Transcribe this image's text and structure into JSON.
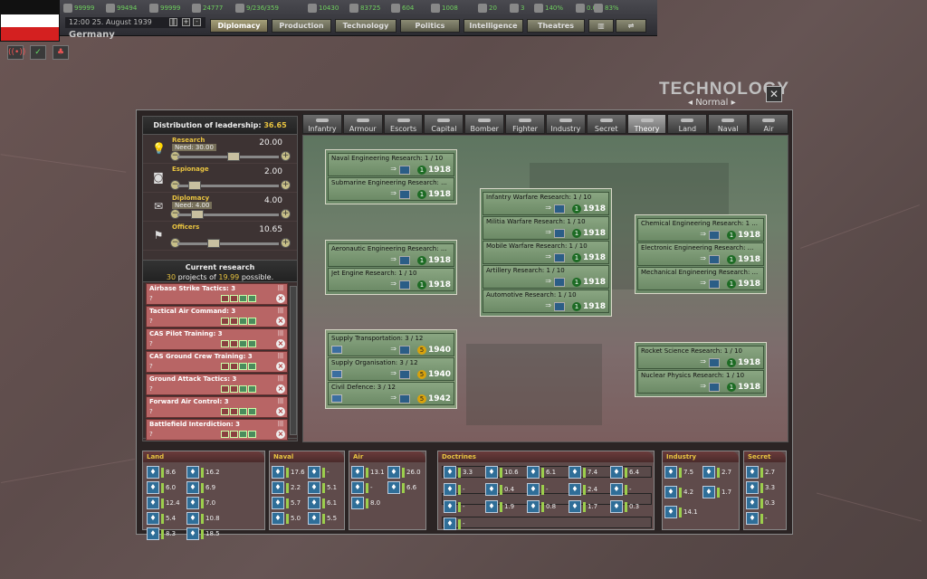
{
  "topbar": {
    "resources": [
      {
        "icon": "energy-icon",
        "value": "99999"
      },
      {
        "icon": "metal-icon",
        "value": "99494"
      },
      {
        "icon": "rare-materials-icon",
        "value": "99999"
      },
      {
        "icon": "oil-icon",
        "value": "24777"
      },
      {
        "icon": "supplies-icon",
        "value": "9/236/359"
      },
      {
        "icon": "money-icon",
        "value": "10430"
      },
      {
        "icon": "fuel-icon",
        "value": "83725"
      },
      {
        "icon": "transport-icon",
        "value": "604"
      },
      {
        "icon": "manpower-icon",
        "value": "1008"
      },
      {
        "icon": "diplomats-icon",
        "value": "20"
      },
      {
        "icon": "spies-icon",
        "value": "3"
      },
      {
        "icon": "dissent-icon",
        "value": "140%"
      },
      {
        "icon": "unity-icon",
        "value": "0.00"
      },
      {
        "icon": "neutrality-icon",
        "value": "83%"
      }
    ],
    "date": "12:00 25. August 1939",
    "country": "Germany",
    "flag_colors": [
      "#111111",
      "#ffffff",
      "#d42020"
    ],
    "tabs": [
      {
        "label": "Diplomacy",
        "active": true
      },
      {
        "label": "Production",
        "active": false
      },
      {
        "label": "Technology",
        "active": false
      },
      {
        "label": "Politics",
        "active": false
      },
      {
        "label": "Intelligence",
        "active": false
      },
      {
        "label": "Theatres",
        "active": false
      }
    ]
  },
  "window": {
    "title": "TECHNOLOGY",
    "subtitle": "Normal",
    "close": "✕"
  },
  "leadership": {
    "title": "Distribution of leadership:",
    "total": "36.65",
    "slots": [
      {
        "name": "Research",
        "need": "Need: 30.00",
        "value": "20.00",
        "icon": "lightbulb-icon",
        "pos": 0.55
      },
      {
        "name": "Espionage",
        "need": "",
        "value": "2.00",
        "icon": "camera-icon",
        "pos": 0.12
      },
      {
        "name": "Diplomacy",
        "need": "Need: 4.00",
        "value": "4.00",
        "icon": "envelope-icon",
        "pos": 0.15
      },
      {
        "name": "Officers",
        "need": "",
        "value": "10.65",
        "icon": "checkered-flag-icon",
        "pos": 0.33
      }
    ]
  },
  "current_research": {
    "title": "Current research",
    "projects": "30",
    "projects_text": "projects of",
    "possible": "19.99",
    "possible_text": "possible.",
    "items": [
      "Airbase Strike Tactics: 3",
      "Tactical Air Command: 3",
      "CAS Pilot Training: 3",
      "CAS Ground Crew Training: 3",
      "Ground Attack Tactics: 3",
      "Forward Air Control: 3",
      "Battlefield Interdiction: 3"
    ],
    "placeholder": "?"
  },
  "tech_tabs": [
    "Infantry",
    "Armour",
    "Escorts",
    "Capital",
    "Bomber",
    "Fighter",
    "Industry",
    "Secret",
    "Theory",
    "Land",
    "Naval",
    "Air"
  ],
  "active_tab": "Theory",
  "tech_groups": [
    {
      "id": "naval-eng",
      "items": [
        {
          "name": "Naval Engineering Research: 1 / 10",
          "level": "1",
          "year": "1918"
        },
        {
          "name": "Submarine Engineering Research: ...",
          "level": "1",
          "year": "1918"
        }
      ]
    },
    {
      "id": "aero",
      "items": [
        {
          "name": "Aeronautic Engineering Research: ...",
          "level": "1",
          "year": "1918"
        },
        {
          "name": "Jet Engine Research: 1 / 10",
          "level": "1",
          "year": "1918"
        }
      ]
    },
    {
      "id": "supply",
      "items": [
        {
          "name": "Supply Transportation: 3 / 12",
          "level": "5",
          "year": "1940"
        },
        {
          "name": "Supply Organisation: 3 / 12",
          "level": "5",
          "year": "1940"
        },
        {
          "name": "Civil Defence: 3 / 12",
          "level": "5",
          "year": "1942"
        }
      ]
    },
    {
      "id": "warfare",
      "items": [
        {
          "name": "Infantry Warfare Research: 1 / 10",
          "level": "1",
          "year": "1918"
        },
        {
          "name": "Militia Warfare Research: 1 / 10",
          "level": "1",
          "year": "1918"
        },
        {
          "name": "Mobile Warfare Research: 1 / 10",
          "level": "1",
          "year": "1918"
        },
        {
          "name": "Artillery Research: 1 / 10",
          "level": "1",
          "year": "1918"
        },
        {
          "name": "Automotive Research: 1 / 10",
          "level": "1",
          "year": "1918"
        }
      ]
    },
    {
      "id": "engineering",
      "items": [
        {
          "name": "Chemical Engineering Research: 1 ...",
          "level": "1",
          "year": "1918"
        },
        {
          "name": "Electronic Engineering Research: ...",
          "level": "1",
          "year": "1918"
        },
        {
          "name": "Mechanical Engineering Research: ...",
          "level": "1",
          "year": "1918"
        }
      ]
    },
    {
      "id": "rocket",
      "items": [
        {
          "name": "Rocket Science Research: 1 / 10",
          "level": "1",
          "year": "1918"
        },
        {
          "name": "Nuclear Physics Research: 1 / 10",
          "level": "1",
          "year": "1918"
        }
      ]
    }
  ],
  "bottom": {
    "land": {
      "title": "Land",
      "values": [
        "8.6",
        "16.2",
        "6.0",
        "6.9",
        "12.4",
        "7.0",
        "5.4",
        "10.8",
        "8.3",
        "18.5"
      ]
    },
    "naval": {
      "title": "Naval",
      "values": [
        "17.6",
        "-",
        "2.2",
        "5.1",
        "5.7",
        "6.1",
        "5.0",
        "5.5"
      ]
    },
    "air": {
      "title": "Air",
      "values": [
        "13.1",
        "26.0",
        "-",
        "6.6",
        "8.0"
      ]
    },
    "doctrines": {
      "title": "Doctrines",
      "values": [
        "3.3",
        "10.6",
        "6.1",
        "7.4",
        "6.4",
        "-",
        "0.4",
        "-",
        "2.4",
        "-",
        "-",
        "1.9",
        "0.8",
        "1.7",
        "0.3",
        "-"
      ]
    },
    "industry": {
      "title": "Industry",
      "values": [
        "7.5",
        "2.7",
        "4.2",
        "1.7",
        "14.1"
      ]
    },
    "secret": {
      "title": "Secret",
      "values": [
        "2.7",
        "3.3",
        "0.3",
        "-"
      ]
    }
  }
}
